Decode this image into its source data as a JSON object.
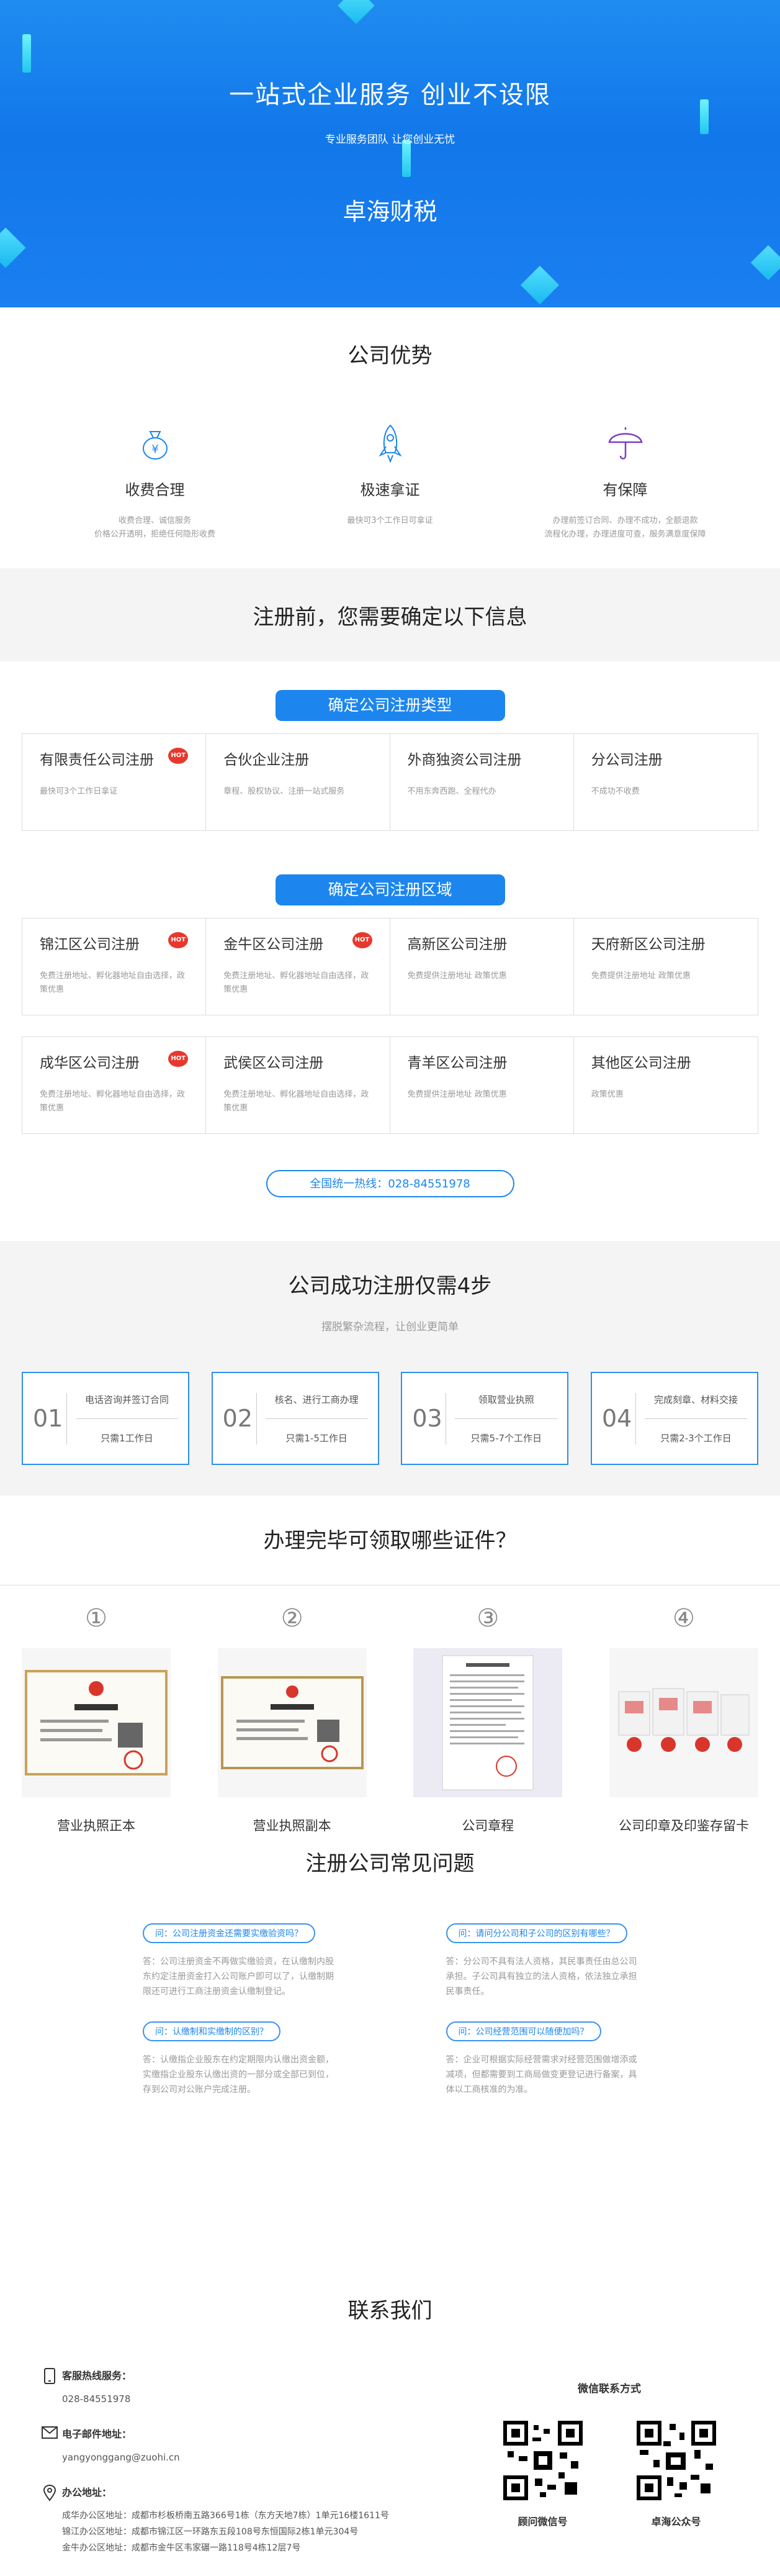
{
  "hero": {
    "title": "一站式企业服务 创业不设限",
    "subtitle": "专业服务团队 让您创业无忧",
    "brand": "卓海财税"
  },
  "advantages": {
    "title": "公司优势",
    "items": [
      {
        "icon": "money-bag-icon",
        "title": "收费合理",
        "line1": "收费合理、诚信服务",
        "line2": "价格公开透明，拒绝任何隐形收费"
      },
      {
        "icon": "rocket-icon",
        "title": "极速拿证",
        "line1": "最快可3个工作日可拿证",
        "line2": ""
      },
      {
        "icon": "umbrella-icon",
        "title": "有保障",
        "line1": "办理前签订合同、办理不成功，全额退款",
        "line2": "流程化办理，办理进度可查，服务满意度保障"
      }
    ]
  },
  "confirm_band": {
    "title": "注册前，您需要确定以下信息"
  },
  "company_type": {
    "pill": "确定公司注册类型",
    "items": [
      {
        "title": "有限责任公司注册",
        "desc": "最快可3个工作日拿证",
        "hot": "HOT"
      },
      {
        "title": "合伙企业注册",
        "desc": "章程、股权协议、注册一站式服务",
        "hot": ""
      },
      {
        "title": "外商独资公司注册",
        "desc": "不用东奔西跑、全程代办",
        "hot": ""
      },
      {
        "title": "分公司注册",
        "desc": "不成功不收费",
        "hot": ""
      }
    ]
  },
  "company_area": {
    "pill": "确定公司注册区域",
    "row1": [
      {
        "title": "锦江区公司注册",
        "desc": "免费注册地址、孵化器地址自由选择，政策优惠",
        "hot": "HOT"
      },
      {
        "title": "金牛区公司注册",
        "desc": "免费注册地址、孵化器地址自由选择，政策优惠",
        "hot": "HOT"
      },
      {
        "title": "高新区公司注册",
        "desc": "免费提供注册地址 政策优惠",
        "hot": ""
      },
      {
        "title": "天府新区公司注册",
        "desc": "免费提供注册地址 政策优惠",
        "hot": ""
      }
    ],
    "row2": [
      {
        "title": "成华区公司注册",
        "desc": "免费注册地址、孵化器地址自由选择，政策优惠",
        "hot": "HOT"
      },
      {
        "title": "武侯区公司注册",
        "desc": "免费注册地址、孵化器地址自由选择，政策优惠",
        "hot": ""
      },
      {
        "title": "青羊区公司注册",
        "desc": "免费提供注册地址 政策优惠",
        "hot": ""
      },
      {
        "title": "其他区公司注册",
        "desc": "政策优惠",
        "hot": ""
      }
    ]
  },
  "hotline": "全国统一热线：028-84551978",
  "steps": {
    "title": "公司成功注册仅需4步",
    "subtitle": "摆脱繁杂流程，让创业更简单",
    "items": [
      {
        "num": "01",
        "line1": "电话咨询并签订合同",
        "line2": "只需1工作日"
      },
      {
        "num": "02",
        "line1": "核名、进行工商办理",
        "line2": "只需1-5工作日"
      },
      {
        "num": "03",
        "line1": "领取营业执照",
        "line2": "只需5-7个工作日"
      },
      {
        "num": "04",
        "line1": "完成刻章、材料交接",
        "line2": "只需2-3个工作日"
      }
    ]
  },
  "docs": {
    "title": "办理完毕可领取哪些证件？",
    "items": [
      {
        "num": "①",
        "caption": "营业执照正本"
      },
      {
        "num": "②",
        "caption": "营业执照副本"
      },
      {
        "num": "③",
        "caption": "公司章程"
      },
      {
        "num": "④",
        "caption": "公司印章及印鉴存留卡"
      }
    ]
  },
  "faq": {
    "title": "注册公司常见问题",
    "items": [
      {
        "q": "问：公司注册资金还需要实缴验资吗？",
        "a": "答：公司注册资金不再做实缴验资，在认缴制内股东约定注册资金打入公司账户即可以了，认缴制期限还可进行工商注册资金认缴制登记。"
      },
      {
        "q": "问：请问分公司和子公司的区别有哪些？",
        "a": "答：分公司不具有法人资格，其民事责任由总公司承担。子公司具有独立的法人资格，依法独立承担民事责任。"
      },
      {
        "q": "问：认缴制和实缴制的区别？",
        "a": "答：认缴指企业股东在约定期限内认缴出资金额，实缴指企业股东认缴出资的一部分或全部已到位，存到公司对公账户完成注册。"
      },
      {
        "q": "问：公司经营范围可以随便加吗？",
        "a": "答：企业可根据实际经营需求对经营范围做增添或减项，但都需要到工商局做变更登记进行备案，具体以工商核准的为准。"
      }
    ]
  },
  "contact": {
    "title": "联系我们",
    "phone_label": "客服热线服务：",
    "phone": "028-84551978",
    "email_label": "电子邮件地址：",
    "email": "yangyonggang@zuohi.cn",
    "office_label": "办公地址：",
    "offices": [
      "成华办公区地址：成都市杉板桥南五路366号1栋（东方天地7栋）1单元16楼1611号",
      "锦江办公区地址：成都市锦江区一环路东五段108号东恒国际2栋1单元304号",
      "金牛办公区地址：成都市金牛区韦家碾一路118号4栋12层7号"
    ],
    "wechat_title": "微信联系方式",
    "qr1_caption": "顾问微信号",
    "qr2_caption": "卓海公众号"
  },
  "colors": {
    "primary": "#1c86ee",
    "hot": "#e8382d"
  }
}
